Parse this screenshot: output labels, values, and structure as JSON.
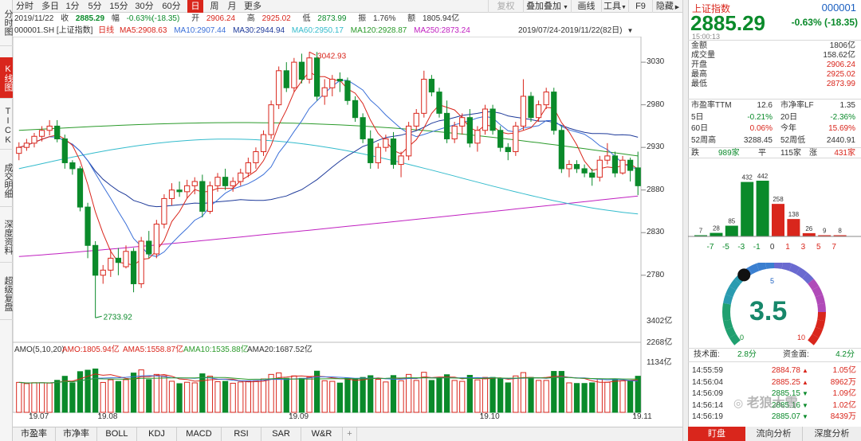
{
  "side_tabs": [
    "分时图",
    "K线图",
    "TICK",
    "成交明细",
    "深度资料",
    "超级复盘"
  ],
  "toolbar": {
    "periods": [
      "分时",
      "多日",
      "1分",
      "5分",
      "15分",
      "30分",
      "60分",
      "日",
      "周",
      "月",
      "更多"
    ],
    "active_period": "日",
    "tools": [
      "复权",
      "叠加叠加",
      "画线",
      "工具",
      "F9",
      "隐藏"
    ],
    "tool_labels": {
      "fuquan": "复权",
      "diejia": "叠加叠加",
      "huaxian": "画线",
      "gongju": "工具",
      "f9": "F9",
      "yincang": "隐藏"
    }
  },
  "info1": {
    "date": "2019/11/22",
    "close_label": "收",
    "close": "2885.29",
    "chg_label": "幅",
    "chg": "-0.63%(-18.35)",
    "open_label": "开",
    "open": "2906.24",
    "high_label": "高",
    "high": "2925.02",
    "low_label": "低",
    "low": "2873.99",
    "amp_label": "振",
    "amp": "1.76%",
    "amt_label": "额",
    "amt": "1805.94亿"
  },
  "info2": {
    "code": "000001.SH [上证指数]",
    "line_label": "日线",
    "ma5": "MA5:2908.63",
    "ma10": "MA10:2907.44",
    "ma30": "MA30:2944.94",
    "ma60": "MA60:2950.17",
    "ma120": "MA120:2928.87",
    "ma250": "MA250:2873.24",
    "range": "2019/07/24-2019/11/22(82日)"
  },
  "colors": {
    "up": "#d9261c",
    "down": "#0a8a2a",
    "ma5": "#d9261c",
    "ma10": "#3a6fd8",
    "ma30": "#1e3a9a",
    "ma60": "#33bbcc",
    "ma120": "#2a9a2a",
    "ma250": "#c020c0"
  },
  "chart_data": {
    "type": "candlestick",
    "price_ticks": [
      3030,
      2980,
      2930,
      2880,
      2830,
      2780
    ],
    "price_range": [
      2720,
      3060
    ],
    "high_mark": "3042.93",
    "low_mark": "2733.92",
    "date_labels": [
      "19.07",
      "19.08",
      "19.09",
      "19.10",
      "19.11"
    ],
    "candles": [
      [
        2923,
        2936,
        2915,
        2930
      ],
      [
        2930,
        2940,
        2926,
        2935
      ],
      [
        2935,
        2947,
        2930,
        2943
      ],
      [
        2943,
        2955,
        2937,
        2950
      ],
      [
        2950,
        2962,
        2944,
        2955
      ],
      [
        2955,
        2962,
        2936,
        2940
      ],
      [
        2940,
        2945,
        2905,
        2912
      ],
      [
        2912,
        2915,
        2898,
        2905
      ],
      [
        2905,
        2908,
        2855,
        2860
      ],
      [
        2860,
        2865,
        2800,
        2815
      ],
      [
        2815,
        2820,
        2730,
        2780
      ],
      [
        2780,
        2792,
        2770,
        2786
      ],
      [
        2786,
        2810,
        2778,
        2800
      ],
      [
        2800,
        2812,
        2780,
        2795
      ],
      [
        2790,
        2815,
        2788,
        2808
      ],
      [
        2808,
        2812,
        2760,
        2770
      ],
      [
        2770,
        2825,
        2765,
        2820
      ],
      [
        2820,
        2832,
        2800,
        2805
      ],
      [
        2805,
        2845,
        2800,
        2840
      ],
      [
        2840,
        2875,
        2835,
        2870
      ],
      [
        2870,
        2888,
        2862,
        2880
      ],
      [
        2880,
        2890,
        2872,
        2878
      ],
      [
        2878,
        2892,
        2870,
        2885
      ],
      [
        2885,
        2895,
        2875,
        2890
      ],
      [
        2890,
        2898,
        2848,
        2855
      ],
      [
        2855,
        2890,
        2852,
        2885
      ],
      [
        2885,
        2900,
        2878,
        2895
      ],
      [
        2895,
        2905,
        2880,
        2885
      ],
      [
        2885,
        2895,
        2878,
        2890
      ],
      [
        2890,
        2905,
        2885,
        2900
      ],
      [
        2900,
        2918,
        2895,
        2912
      ],
      [
        2912,
        2930,
        2905,
        2925
      ],
      [
        2925,
        2950,
        2920,
        2945
      ],
      [
        2945,
        2985,
        2940,
        2980
      ],
      [
        2980,
        3025,
        2975,
        3020
      ],
      [
        3020,
        3030,
        2995,
        3000
      ],
      [
        3000,
        3035,
        2995,
        3030
      ],
      [
        3030,
        3040,
        3005,
        3010
      ],
      [
        3010,
        3042,
        3005,
        3035
      ],
      [
        3035,
        3042,
        2985,
        2990
      ],
      [
        2990,
        3010,
        2980,
        3000
      ],
      [
        3000,
        3015,
        2990,
        3010
      ],
      [
        3010,
        3018,
        2995,
        3008
      ],
      [
        3008,
        3012,
        2980,
        2985
      ],
      [
        2985,
        2990,
        2960,
        2965
      ],
      [
        2965,
        2970,
        2935,
        2940
      ],
      [
        2940,
        2950,
        2905,
        2912
      ],
      [
        2912,
        2935,
        2905,
        2930
      ],
      [
        2930,
        2945,
        2925,
        2940
      ],
      [
        2940,
        2948,
        2905,
        2910
      ],
      [
        2910,
        2925,
        2895,
        2920
      ],
      [
        2920,
        2960,
        2915,
        2955
      ],
      [
        2955,
        2975,
        2950,
        2970
      ],
      [
        2970,
        3020,
        2965,
        3010
      ],
      [
        3010,
        3015,
        2990,
        2995
      ],
      [
        2995,
        3000,
        2965,
        2970
      ],
      [
        2970,
        2985,
        2935,
        2940
      ],
      [
        2940,
        2960,
        2935,
        2955
      ],
      [
        2955,
        2970,
        2945,
        2965
      ],
      [
        2965,
        2975,
        2930,
        2935
      ],
      [
        2935,
        2955,
        2925,
        2950
      ],
      [
        2950,
        2980,
        2945,
        2975
      ],
      [
        2975,
        2980,
        2945,
        2950
      ],
      [
        2950,
        2955,
        2925,
        2930
      ],
      [
        2930,
        2935,
        2915,
        2925
      ],
      [
        2925,
        2960,
        2920,
        2955
      ],
      [
        2955,
        3010,
        2950,
        2990
      ],
      [
        2990,
        2995,
        2960,
        2965
      ],
      [
        2965,
        2985,
        2960,
        2980
      ],
      [
        2980,
        3000,
        2975,
        2995
      ],
      [
        2995,
        3000,
        2945,
        2950
      ],
      [
        2950,
        2955,
        2900,
        2905
      ],
      [
        2905,
        2915,
        2895,
        2910
      ],
      [
        2910,
        2915,
        2900,
        2905
      ],
      [
        2905,
        2910,
        2895,
        2900
      ],
      [
        2900,
        2905,
        2885,
        2895
      ],
      [
        2895,
        2920,
        2890,
        2915
      ],
      [
        2915,
        2935,
        2910,
        2920
      ],
      [
        2920,
        2925,
        2895,
        2900
      ],
      [
        2900,
        2920,
        2898,
        2915
      ],
      [
        2915,
        2918,
        2890,
        2903
      ],
      [
        2906,
        2925,
        2874,
        2885
      ]
    ],
    "amo_legend": {
      "title": "AMO(5,10,20)",
      "amo": "AMO:1805.94亿",
      "ma5": "AMA5:1558.87亿",
      "ma10": "AMA10:1535.88亿",
      "ma20": "AMA20:1687.52亿"
    },
    "amo_ticks": [
      "3402亿",
      "2268亿",
      "1134亿"
    ]
  },
  "bottom_tabs": [
    "市盈率",
    "市净率",
    "BOLL",
    "KDJ",
    "MACD",
    "RSI",
    "SAR",
    "W&R"
  ],
  "plus_icon": "+",
  "right_panel": {
    "name": "上证指数",
    "code": "000001",
    "price": "2885.29",
    "change": "-0.63%  (-18.35)",
    "time": "15:00:13",
    "rows": [
      {
        "k": "金额",
        "v": "1806亿",
        "cls": ""
      },
      {
        "k": "成交量",
        "v": "158.62亿",
        "cls": ""
      },
      {
        "k": "开盘",
        "v": "2906.24",
        "cls": "up"
      },
      {
        "k": "最高",
        "v": "2925.02",
        "cls": "up"
      },
      {
        "k": "最低",
        "v": "2873.99",
        "cls": "up"
      }
    ],
    "pairs": [
      {
        "k1": "市盈率TTM",
        "v1": "12.6",
        "c1": "",
        "k2": "市净率LF",
        "v2": "1.35",
        "c2": ""
      },
      {
        "k1": "5日",
        "v1": "-0.21%",
        "c1": "down",
        "k2": "20日",
        "v2": "-2.36%",
        "c2": "down"
      },
      {
        "k1": "60日",
        "v1": "0.06%",
        "c1": "up",
        "k2": "今年",
        "v2": "15.69%",
        "c2": "up"
      },
      {
        "k1": "52周高",
        "v1": "3288.45",
        "c1": "",
        "k2": "52周低",
        "v2": "2440.91",
        "c2": ""
      }
    ],
    "breadth": {
      "down_label": "跌",
      "down": "989家",
      "flat_label": "平",
      "flat": "115家",
      "up_label": "涨",
      "up": "431家"
    },
    "dist": {
      "values": [
        7,
        28,
        85,
        432,
        442,
        258,
        138,
        26,
        9,
        8
      ],
      "labels": [
        "7",
        "28",
        "85",
        "432",
        "442",
        "258",
        "138",
        "26",
        "9",
        "8"
      ],
      "x_labels": [
        "-7",
        "-5",
        "-3",
        "-1",
        "0",
        "1",
        "3",
        "5",
        "7"
      ]
    },
    "gauge": {
      "value": "3.5",
      "v": 3.5,
      "min": "0",
      "mid": "5",
      "max": "10"
    },
    "tech": {
      "label": "技术面:",
      "value": "2.8分",
      "label2": "资金面:",
      "value2": "4.2分"
    },
    "trades": [
      {
        "t": "14:55:59",
        "p": "2884.78",
        "d": "up",
        "vol": "1.05亿"
      },
      {
        "t": "14:56:04",
        "p": "2885.25",
        "d": "up",
        "vol": "8962万"
      },
      {
        "t": "14:56:09",
        "p": "2885.15",
        "d": "down",
        "vol": "1.09亿"
      },
      {
        "t": "14:56:14",
        "p": "2885.16",
        "d": "down",
        "vol": "1.02亿"
      },
      {
        "t": "14:56:19",
        "p": "2885.07",
        "d": "down",
        "vol": "8439万"
      }
    ],
    "watermark": "老狼大雪",
    "bottom": [
      "盯盘",
      "流向分析",
      "深度分析"
    ]
  }
}
